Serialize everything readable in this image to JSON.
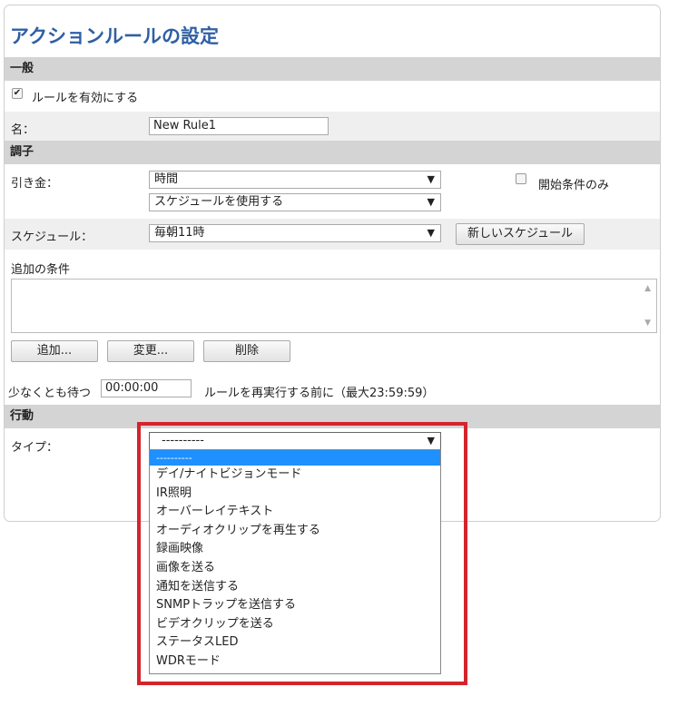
{
  "header": {
    "title": "アクションルールの設定"
  },
  "general": {
    "section_label": "一般",
    "enable_label": "ルールを有効にする",
    "enable_checked": true,
    "name_label": "名：",
    "name_value": "New Rule1"
  },
  "condition": {
    "section_label": "調子",
    "trigger_label": "引き金：",
    "trigger_value": "時間",
    "trigger_sub_value": "スケジュールを使用する",
    "start_only_label": "開始条件のみ",
    "start_only_checked": false,
    "schedule_label": "スケジュール：",
    "schedule_value": "毎朝11時",
    "new_schedule_button": "新しいスケジュール",
    "additional_label": "追加の条件",
    "add_button": "追加...",
    "change_button": "変更...",
    "delete_button": "削除",
    "wait_label": "少なくとも待つ",
    "wait_value": "00:00:00",
    "wait_suffix": "ルールを再実行する前に（最大23:59:59）"
  },
  "action": {
    "section_label": "行動",
    "type_label": "タイプ：",
    "type_value": "----------",
    "options": [
      "----------",
      "デイ/ナイトビジョンモード",
      "IR照明",
      "オーバーレイテキスト",
      "オーディオクリップを再生する",
      "録画映像",
      "画像を送る",
      "通知を送信する",
      "SNMPトラップを送信する",
      "ビデオクリップを送る",
      "ステータスLED",
      "WDRモード"
    ],
    "selected_index": 0
  },
  "colors": {
    "title": "#2f5fa3",
    "highlight": "#1e90ff",
    "callout": "#d3242c"
  }
}
